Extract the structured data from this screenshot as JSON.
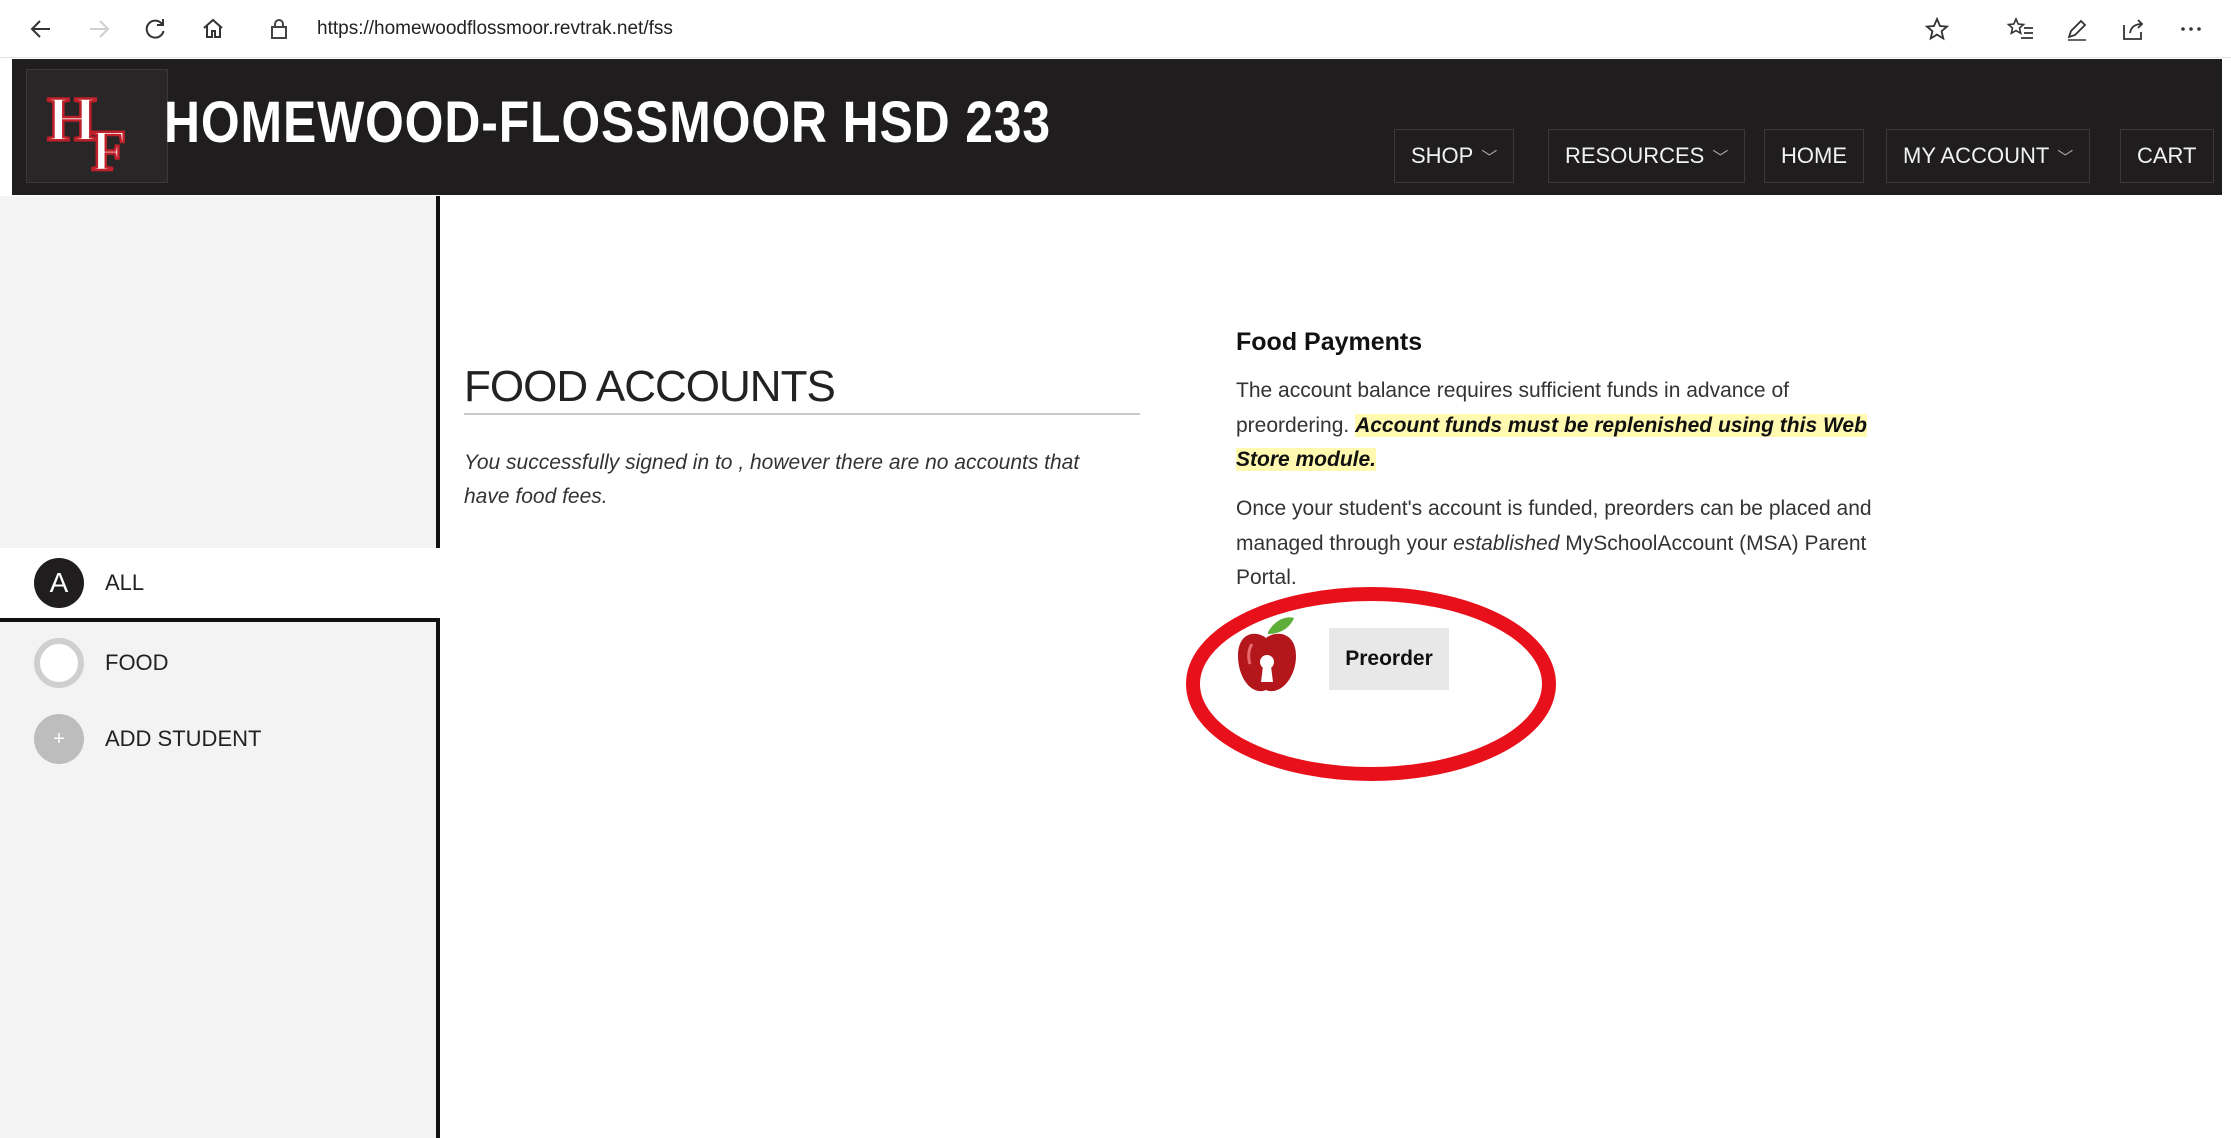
{
  "browser": {
    "url": "https://homewoodflossmoor.revtrak.net/fss",
    "icons": [
      "back-icon",
      "forward-icon",
      "refresh-icon",
      "home-icon",
      "lock-icon",
      "star-icon",
      "favorites-icon",
      "pen-icon",
      "share-icon",
      "more-icon"
    ]
  },
  "header": {
    "title": "HOMEWOOD-FLOSSMOOR HSD 233",
    "logo_text": "HF",
    "nav": [
      {
        "label": "SHOP",
        "has_dropdown": true
      },
      {
        "label": "RESOURCES",
        "has_dropdown": true
      },
      {
        "label": "HOME",
        "has_dropdown": false
      },
      {
        "label": "MY ACCOUNT",
        "has_dropdown": true
      },
      {
        "label": "CART",
        "has_dropdown": false
      }
    ]
  },
  "sidebar": {
    "items": [
      {
        "label": "ALL",
        "initial": "A",
        "active": true
      },
      {
        "label": "FOOD",
        "initial": "",
        "active": false
      },
      {
        "label": "ADD STUDENT",
        "initial": "+",
        "active": false
      }
    ]
  },
  "food_accounts": {
    "title": "FOOD ACCOUNTS",
    "message": "You successfully signed in to , however there are no accounts that have food fees."
  },
  "food_payments": {
    "title": "Food Payments",
    "para1_text": "The account balance requires sufficient funds in advance of preordering. ",
    "para1_highlight": "Account funds must be replenished using this Web Store module.",
    "para2_a": "Once your student's account is funded, preorders can be placed and managed through your ",
    "para2_em": "established",
    "para2_b": " MySchoolAccount (MSA) Parent Portal.",
    "preorder_label": "Preorder"
  },
  "colors": {
    "header_bg": "#1f1d1d",
    "sidebar_bg": "#f3f3f3",
    "highlight": "#fffab0",
    "annotation": "#e8101a"
  }
}
